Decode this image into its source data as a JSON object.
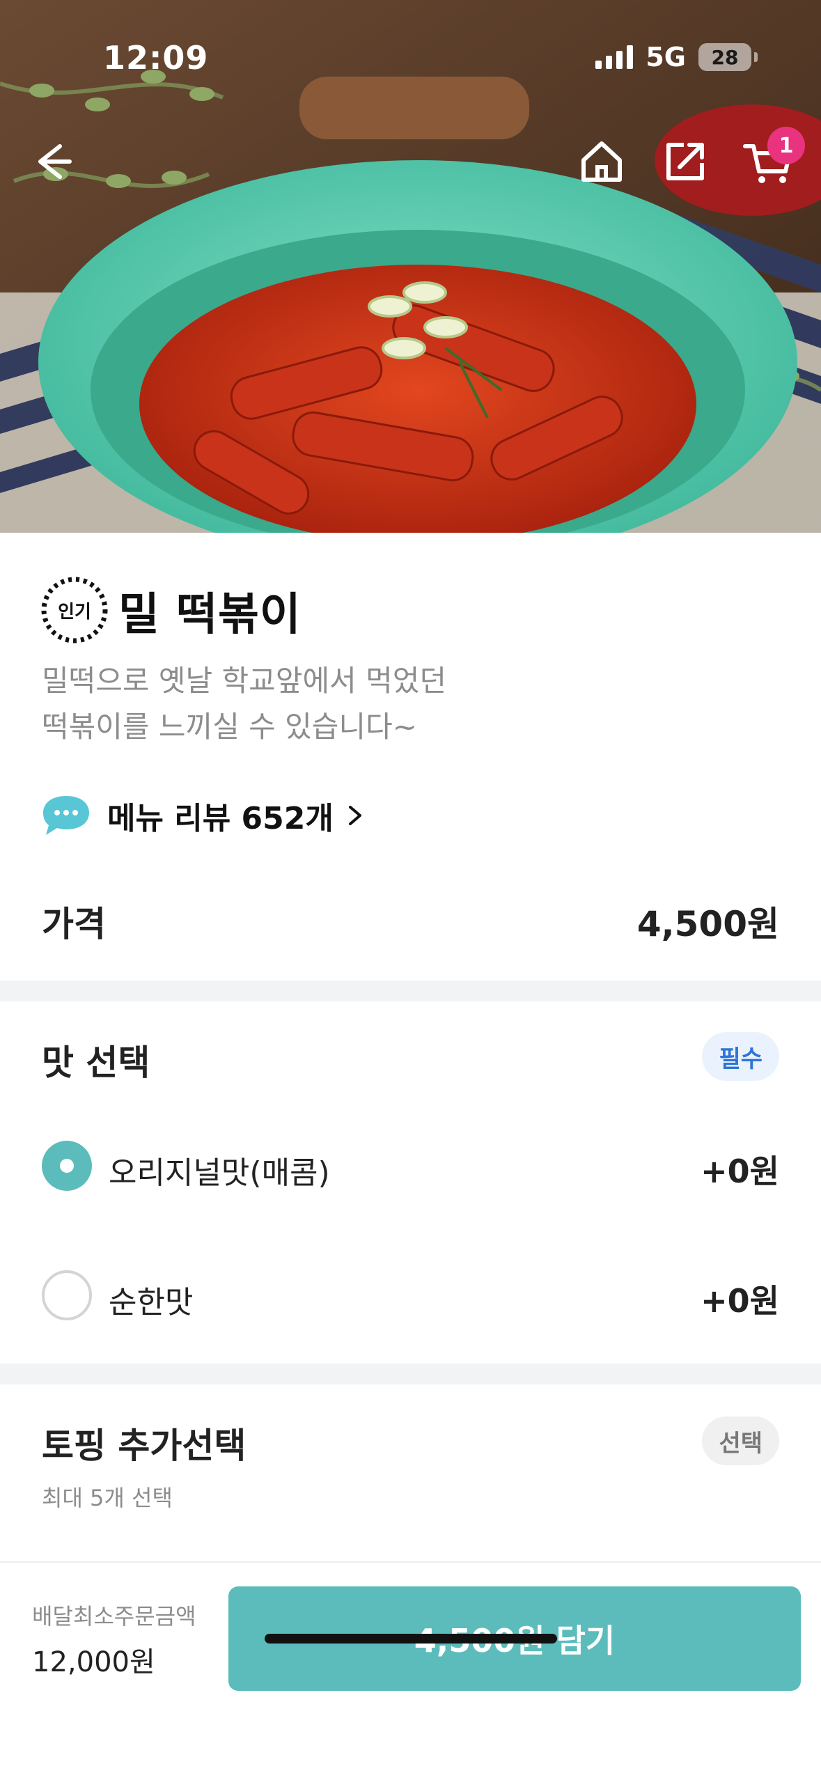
{
  "status_bar": {
    "time": "12:09",
    "network": "5G",
    "battery": "28"
  },
  "header": {
    "cart_count": "1",
    "icons": [
      "back-arrow-icon",
      "home-icon",
      "share-icon",
      "cart-icon"
    ]
  },
  "menu": {
    "badge_text": "인기",
    "name": "밀 떡볶이",
    "description_lines": [
      "밀떡으로 옛날 학교앞에서 먹었던",
      "떡볶이를 느끼실 수 있습니다~"
    ],
    "review_label": "메뉴 리뷰 652개",
    "price_label": "가격",
    "price_value": "4,500원"
  },
  "flavor": {
    "title": "맛 선택",
    "tag": "필수",
    "options": [
      {
        "label": "오리지널맛(매콤)",
        "price": "+0원",
        "selected": true
      },
      {
        "label": "순한맛",
        "price": "+0원",
        "selected": false
      }
    ]
  },
  "topping": {
    "title": "토핑 추가선택",
    "tag": "선택",
    "subtitle": "최대 5개 선택"
  },
  "bottom_bar": {
    "min_order_label": "배달최소주문금액",
    "min_order_value": "12,000원",
    "cta_label": "4,500원 담기"
  },
  "colors": {
    "accent": "#5cbcbc",
    "badge": "#e9337f",
    "required_tag": "#2f74d6"
  }
}
